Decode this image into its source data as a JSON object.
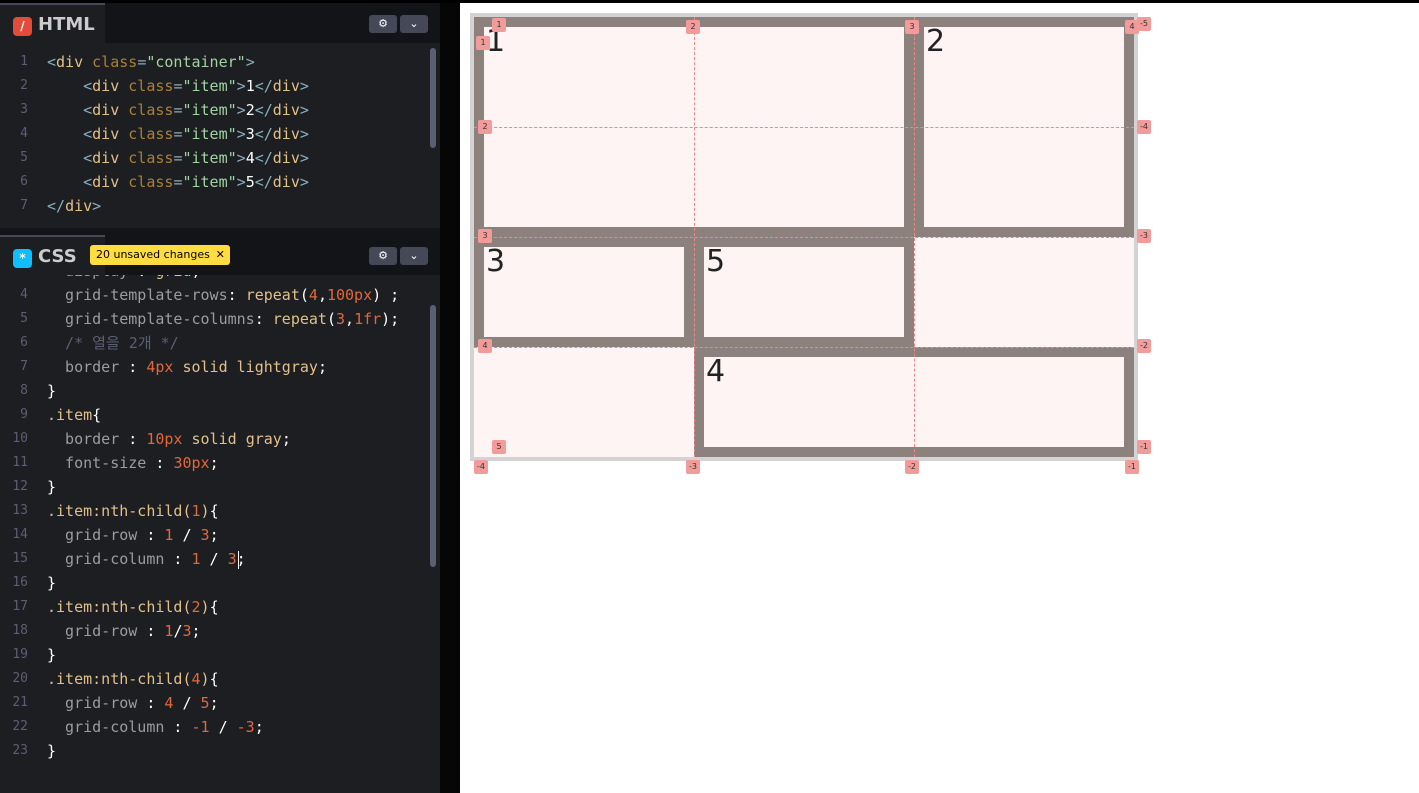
{
  "html_pane": {
    "title": "HTML",
    "icon": "html-icon",
    "lines": [
      {
        "n": "1",
        "parts": [
          [
            "k-punc",
            "<"
          ],
          [
            "k-tag",
            "div"
          ],
          [
            "k-plain",
            " "
          ],
          [
            "k-attr",
            "class"
          ],
          [
            "k-punc",
            "="
          ],
          [
            "k-str",
            "\"container\""
          ],
          [
            "k-punc",
            ">"
          ]
        ]
      },
      {
        "n": "2",
        "parts": [
          [
            "k-plain",
            "    "
          ],
          [
            "k-punc",
            "<"
          ],
          [
            "k-tag",
            "div"
          ],
          [
            "k-plain",
            " "
          ],
          [
            "k-attr",
            "class"
          ],
          [
            "k-punc",
            "="
          ],
          [
            "k-str",
            "\"item\""
          ],
          [
            "k-punc",
            ">"
          ],
          [
            "k-text",
            "1"
          ],
          [
            "k-punc",
            "</"
          ],
          [
            "k-tag",
            "div"
          ],
          [
            "k-punc",
            ">"
          ]
        ]
      },
      {
        "n": "3",
        "parts": [
          [
            "k-plain",
            "    "
          ],
          [
            "k-punc",
            "<"
          ],
          [
            "k-tag",
            "div"
          ],
          [
            "k-plain",
            " "
          ],
          [
            "k-attr",
            "class"
          ],
          [
            "k-punc",
            "="
          ],
          [
            "k-str",
            "\"item\""
          ],
          [
            "k-punc",
            ">"
          ],
          [
            "k-text",
            "2"
          ],
          [
            "k-punc",
            "</"
          ],
          [
            "k-tag",
            "div"
          ],
          [
            "k-punc",
            ">"
          ]
        ]
      },
      {
        "n": "4",
        "parts": [
          [
            "k-plain",
            "    "
          ],
          [
            "k-punc",
            "<"
          ],
          [
            "k-tag",
            "div"
          ],
          [
            "k-plain",
            " "
          ],
          [
            "k-attr",
            "class"
          ],
          [
            "k-punc",
            "="
          ],
          [
            "k-str",
            "\"item\""
          ],
          [
            "k-punc",
            ">"
          ],
          [
            "k-text",
            "3"
          ],
          [
            "k-punc",
            "</"
          ],
          [
            "k-tag",
            "div"
          ],
          [
            "k-punc",
            ">"
          ]
        ]
      },
      {
        "n": "5",
        "parts": [
          [
            "k-plain",
            "    "
          ],
          [
            "k-punc",
            "<"
          ],
          [
            "k-tag",
            "div"
          ],
          [
            "k-plain",
            " "
          ],
          [
            "k-attr",
            "class"
          ],
          [
            "k-punc",
            "="
          ],
          [
            "k-str",
            "\"item\""
          ],
          [
            "k-punc",
            ">"
          ],
          [
            "k-text",
            "4"
          ],
          [
            "k-punc",
            "</"
          ],
          [
            "k-tag",
            "div"
          ],
          [
            "k-punc",
            ">"
          ]
        ]
      },
      {
        "n": "6",
        "parts": [
          [
            "k-plain",
            "    "
          ],
          [
            "k-punc",
            "<"
          ],
          [
            "k-tag",
            "div"
          ],
          [
            "k-plain",
            " "
          ],
          [
            "k-attr",
            "class"
          ],
          [
            "k-punc",
            "="
          ],
          [
            "k-str",
            "\"item\""
          ],
          [
            "k-punc",
            ">"
          ],
          [
            "k-text",
            "5"
          ],
          [
            "k-punc",
            "</"
          ],
          [
            "k-tag",
            "div"
          ],
          [
            "k-punc",
            ">"
          ]
        ]
      },
      {
        "n": "7",
        "parts": [
          [
            "k-punc",
            "</"
          ],
          [
            "k-tag",
            "div"
          ],
          [
            "k-punc",
            ">"
          ]
        ]
      }
    ]
  },
  "css_pane": {
    "title": "CSS",
    "icon": "css-icon",
    "unsaved_label": "20 unsaved changes",
    "unsaved_close": "✕",
    "lines": [
      {
        "n": "",
        "parts": [
          [
            "k-prop",
            "  display"
          ],
          [
            "k-plain",
            " : "
          ],
          [
            "k-val",
            "grid"
          ],
          [
            "k-plain",
            ";"
          ]
        ]
      },
      {
        "n": "4",
        "parts": [
          [
            "k-prop",
            "  grid-template-rows"
          ],
          [
            "k-plain",
            ": "
          ],
          [
            "k-val",
            "repeat"
          ],
          [
            "k-plain",
            "("
          ],
          [
            "k-num",
            "4"
          ],
          [
            "k-plain",
            ","
          ],
          [
            "k-num",
            "100px"
          ],
          [
            "k-plain",
            ") ;"
          ]
        ]
      },
      {
        "n": "5",
        "parts": [
          [
            "k-prop",
            "  grid-template-columns"
          ],
          [
            "k-plain",
            ": "
          ],
          [
            "k-val",
            "repeat"
          ],
          [
            "k-plain",
            "("
          ],
          [
            "k-num",
            "3"
          ],
          [
            "k-plain",
            ","
          ],
          [
            "k-num",
            "1fr"
          ],
          [
            "k-plain",
            ");"
          ]
        ]
      },
      {
        "n": "6",
        "parts": [
          [
            "k-com",
            "  /* 열을 2개 */"
          ]
        ]
      },
      {
        "n": "7",
        "parts": [
          [
            "k-prop",
            "  border"
          ],
          [
            "k-plain",
            " : "
          ],
          [
            "k-num",
            "4px"
          ],
          [
            "k-plain",
            " "
          ],
          [
            "k-val",
            "solid"
          ],
          [
            "k-plain",
            " "
          ],
          [
            "k-val",
            "lightgray"
          ],
          [
            "k-plain",
            ";"
          ]
        ]
      },
      {
        "n": "8",
        "parts": [
          [
            "k-plain",
            "}"
          ]
        ]
      },
      {
        "n": "9",
        "parts": [
          [
            "k-sel",
            ".item"
          ],
          [
            "k-plain",
            "{"
          ]
        ]
      },
      {
        "n": "10",
        "parts": [
          [
            "k-prop",
            "  border"
          ],
          [
            "k-plain",
            " : "
          ],
          [
            "k-num",
            "10px"
          ],
          [
            "k-plain",
            " "
          ],
          [
            "k-val",
            "solid"
          ],
          [
            "k-plain",
            " "
          ],
          [
            "k-val",
            "gray"
          ],
          [
            "k-plain",
            ";"
          ]
        ]
      },
      {
        "n": "11",
        "parts": [
          [
            "k-prop",
            "  font-size"
          ],
          [
            "k-plain",
            " : "
          ],
          [
            "k-num",
            "30px"
          ],
          [
            "k-plain",
            ";"
          ]
        ]
      },
      {
        "n": "12",
        "parts": [
          [
            "k-plain",
            "}"
          ]
        ]
      },
      {
        "n": "13",
        "parts": [
          [
            "k-sel",
            ".item:nth-child("
          ],
          [
            "k-num",
            "1"
          ],
          [
            "k-sel",
            ")"
          ],
          [
            "k-plain",
            "{"
          ]
        ]
      },
      {
        "n": "14",
        "parts": [
          [
            "k-prop",
            "  grid-row"
          ],
          [
            "k-plain",
            " : "
          ],
          [
            "k-num",
            "1"
          ],
          [
            "k-plain",
            " / "
          ],
          [
            "k-num",
            "3"
          ],
          [
            "k-plain",
            ";"
          ]
        ]
      },
      {
        "n": "15",
        "parts": [
          [
            "k-prop",
            "  grid-column"
          ],
          [
            "k-plain",
            " : "
          ],
          [
            "k-num",
            "1"
          ],
          [
            "k-plain",
            " / "
          ],
          [
            "k-num",
            "3"
          ],
          [
            "k-plain",
            ";"
          ]
        ]
      },
      {
        "n": "16",
        "parts": [
          [
            "k-plain",
            "}"
          ]
        ]
      },
      {
        "n": "17",
        "parts": [
          [
            "k-sel",
            ".item:nth-child("
          ],
          [
            "k-num",
            "2"
          ],
          [
            "k-sel",
            ")"
          ],
          [
            "k-plain",
            "{"
          ]
        ]
      },
      {
        "n": "18",
        "parts": [
          [
            "k-prop",
            "  grid-row"
          ],
          [
            "k-plain",
            " : "
          ],
          [
            "k-num",
            "1"
          ],
          [
            "k-plain",
            "/"
          ],
          [
            "k-num",
            "3"
          ],
          [
            "k-plain",
            ";"
          ]
        ]
      },
      {
        "n": "19",
        "parts": [
          [
            "k-plain",
            "}"
          ]
        ]
      },
      {
        "n": "20",
        "parts": [
          [
            "k-sel",
            ".item:nth-child("
          ],
          [
            "k-num",
            "4"
          ],
          [
            "k-sel",
            ")"
          ],
          [
            "k-plain",
            "{"
          ]
        ]
      },
      {
        "n": "21",
        "parts": [
          [
            "k-prop",
            "  grid-row"
          ],
          [
            "k-plain",
            " : "
          ],
          [
            "k-num",
            "4"
          ],
          [
            "k-plain",
            " / "
          ],
          [
            "k-num",
            "5"
          ],
          [
            "k-plain",
            ";"
          ]
        ]
      },
      {
        "n": "22",
        "parts": [
          [
            "k-prop",
            "  grid-column"
          ],
          [
            "k-plain",
            " : "
          ],
          [
            "k-num",
            "-1"
          ],
          [
            "k-plain",
            " / "
          ],
          [
            "k-num",
            "-3"
          ],
          [
            "k-plain",
            ";"
          ]
        ]
      },
      {
        "n": "23",
        "parts": [
          [
            "k-plain",
            "}"
          ]
        ]
      }
    ]
  },
  "header_buttons": {
    "settings_icon": "gear-icon",
    "collapse_icon": "chevron-down-icon"
  },
  "preview": {
    "items": [
      {
        "label": "1"
      },
      {
        "label": "2"
      },
      {
        "label": "3"
      },
      {
        "label": "5"
      },
      {
        "label": "4"
      }
    ],
    "top_labels": [
      "1",
      "2",
      "3",
      "4",
      "-5"
    ],
    "left_labels": [
      "1",
      "2",
      "3",
      "4",
      "5"
    ],
    "right_labels": [
      "-4",
      "-3",
      "-2",
      "-1"
    ],
    "bottom_labels": [
      "-4",
      "-3",
      "-2",
      "-1"
    ]
  }
}
